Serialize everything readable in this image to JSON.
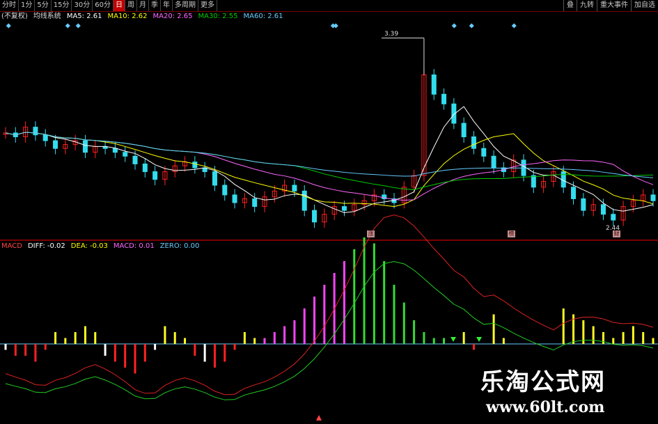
{
  "toolbar": {
    "periods": [
      "分时",
      "1分",
      "5分",
      "15分",
      "30分",
      "60分",
      "日",
      "周",
      "月",
      "季",
      "年",
      "多周期",
      "更多"
    ],
    "active_index": 6,
    "right_tools": [
      "叠",
      "九转",
      "重大事件",
      "加自选"
    ]
  },
  "ma_legend": {
    "prefix": "(不复权)",
    "name": "均线系统",
    "items": [
      {
        "label": "MA5: 2.61",
        "color": "#ffffff"
      },
      {
        "label": "MA10: 2.62",
        "color": "#ffff00"
      },
      {
        "label": "MA20: 2.65",
        "color": "#ff66ff"
      },
      {
        "label": "MA30: 2.55",
        "color": "#00cc00"
      },
      {
        "label": "MA60: 2.61",
        "color": "#66ccff"
      }
    ]
  },
  "macd_legend": {
    "prefix": "MACD",
    "items": [
      {
        "label": "DIFF: -0.02",
        "color": "#ffffff"
      },
      {
        "label": "DEA: -0.03",
        "color": "#ffff00"
      },
      {
        "label": "MACD: 0.01",
        "color": "#ff66ff"
      },
      {
        "label": "ZERO: 0.00",
        "color": "#66ccff"
      }
    ]
  },
  "price_labels": {
    "high": "3.39",
    "low": "2.44"
  },
  "events": [
    "涨",
    "榜",
    "财"
  ],
  "watermark": {
    "title": "乐淘公式网",
    "url": "www.60lt.com"
  },
  "colors": {
    "up": "#ff2222",
    "down": "#33ddee",
    "ma5": "#ffffff",
    "ma10": "#ffff00",
    "ma20": "#ff66ff",
    "ma30": "#00cc00",
    "ma60": "#66ccff",
    "diff": "#dd2222",
    "dea": "#22cc22"
  },
  "chart_data": [
    {
      "type": "candlestick",
      "closes": [
        2.9,
        2.88,
        2.93,
        2.89,
        2.86,
        2.82,
        2.84,
        2.86,
        2.8,
        2.83,
        2.82,
        2.8,
        2.78,
        2.74,
        2.7,
        2.66,
        2.7,
        2.73,
        2.75,
        2.72,
        2.7,
        2.63,
        2.58,
        2.54,
        2.56,
        2.52,
        2.57,
        2.6,
        2.63,
        2.6,
        2.5,
        2.44,
        2.48,
        2.52,
        2.5,
        2.53,
        2.55,
        2.58,
        2.56,
        2.54,
        2.62,
        2.68,
        3.2,
        3.1,
        3.05,
        2.95,
        2.88,
        2.82,
        2.78,
        2.72,
        2.7,
        2.76,
        2.68,
        2.62,
        2.65,
        2.7,
        2.62,
        2.56,
        2.5,
        2.53,
        2.48,
        2.45,
        2.52,
        2.55,
        2.58,
        2.55
      ],
      "high": 3.39,
      "low": 2.44
    },
    {
      "type": "bar",
      "macd": [
        -0.01,
        -0.02,
        -0.02,
        -0.03,
        -0.01,
        0.02,
        0.01,
        0.02,
        0.03,
        0.02,
        -0.02,
        -0.03,
        -0.04,
        -0.05,
        -0.03,
        -0.01,
        0.03,
        0.02,
        0.01,
        -0.02,
        -0.03,
        -0.04,
        -0.03,
        -0.01,
        0.02,
        0.01,
        0.01,
        0.02,
        0.03,
        0.04,
        0.06,
        0.08,
        0.1,
        0.12,
        0.14,
        0.16,
        0.18,
        0.17,
        0.14,
        0.1,
        0.07,
        0.04,
        0.02,
        0.01,
        0.01,
        0.0,
        0.02,
        -0.01,
        0.0,
        0.05,
        0.01,
        0.0,
        0.0,
        0.0,
        0.0,
        0.0,
        0.06,
        0.05,
        0.04,
        0.03,
        0.02,
        0.01,
        0.02,
        0.03,
        0.02,
        0.01
      ]
    }
  ]
}
